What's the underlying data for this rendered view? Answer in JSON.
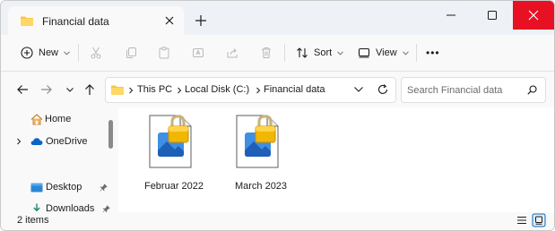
{
  "tab": {
    "title": "Financial data",
    "icon": "folder-icon"
  },
  "toolbar": {
    "new_label": "New",
    "sort_label": "Sort",
    "view_label": "View",
    "more_label": "•••"
  },
  "address": {
    "segments": [
      "This PC",
      "Local Disk (C:)",
      "Financial data"
    ]
  },
  "search": {
    "placeholder": "Search Financial data"
  },
  "nav": {
    "items": [
      {
        "label": "Home",
        "icon": "home-icon"
      },
      {
        "label": "OneDrive",
        "icon": "onedrive-icon"
      },
      {
        "label": "Desktop",
        "icon": "desktop-icon"
      },
      {
        "label": "Downloads",
        "icon": "downloads-icon"
      }
    ]
  },
  "files": [
    {
      "name": "Februar 2022",
      "icon": "locked-image-file-icon"
    },
    {
      "name": "March 2023",
      "icon": "locked-image-file-icon"
    }
  ],
  "status": {
    "count": "2 items"
  },
  "colors": {
    "accent": "#0067c0",
    "folder": "#f7c64a",
    "close": "#e81123",
    "lock": "#f2b705"
  }
}
